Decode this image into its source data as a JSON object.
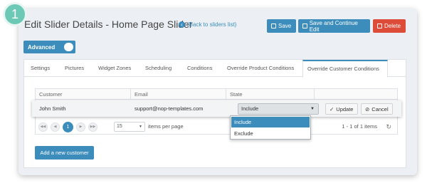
{
  "step_number": "1",
  "header": {
    "title": "Edit Slider Details - Home Page Slider",
    "back_link": "(Back to sliders list)",
    "save_label": "Save",
    "save_continue_label": "Save and Continue Edit",
    "delete_label": "Delete"
  },
  "advanced_toggle": {
    "label": "Advanced"
  },
  "tabs": [
    {
      "label": "Settings"
    },
    {
      "label": "Pictures"
    },
    {
      "label": "Widget Zones"
    },
    {
      "label": "Scheduling"
    },
    {
      "label": "Conditions"
    },
    {
      "label": "Override Product Conditions"
    },
    {
      "label": "Override Customer Conditions",
      "active": true
    }
  ],
  "grid": {
    "columns": [
      "Customer",
      "Email",
      "State"
    ],
    "rows": [
      {
        "customer": "John Smith",
        "email": "support@nop-templates.com",
        "state": "Include"
      }
    ],
    "update_label": "Update",
    "cancel_label": "Cancel"
  },
  "state_dropdown": {
    "options": [
      "Include",
      "Exclude"
    ],
    "highlighted": "Include"
  },
  "pager": {
    "current_page": "1",
    "page_size": "15",
    "items_per_page_label": "items per page",
    "range_text": "1 - 1 of 1 items"
  },
  "add_button_label": "Add a new customer",
  "colors": {
    "accent": "#3c8dbc",
    "danger": "#dd4b39",
    "badge": "#6cc9b6"
  }
}
